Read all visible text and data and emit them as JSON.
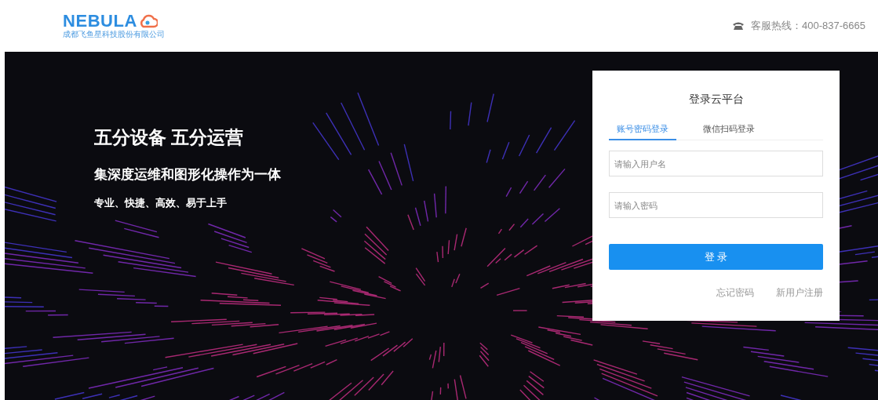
{
  "header": {
    "logo": "NEBULA",
    "company": "成都飞鱼星科技股份有限公司",
    "hotline": "客服热线：400-837-6665"
  },
  "hero": {
    "title": "五分设备 五分运营",
    "subtitle": "集深度运维和图形化操作为一体",
    "tagline": "专业、快捷、高效、易于上手"
  },
  "login": {
    "title": "登录云平台",
    "tabs": [
      {
        "label": "账号密码登录",
        "selected": true
      },
      {
        "label": "微信扫码登录",
        "selected": false
      }
    ],
    "fields": [
      {
        "placeholder": "请输入用户名"
      },
      {
        "placeholder": "请输入密码"
      }
    ],
    "submit": "登 录",
    "links": [
      "忘记密码",
      "新用户注册"
    ]
  }
}
